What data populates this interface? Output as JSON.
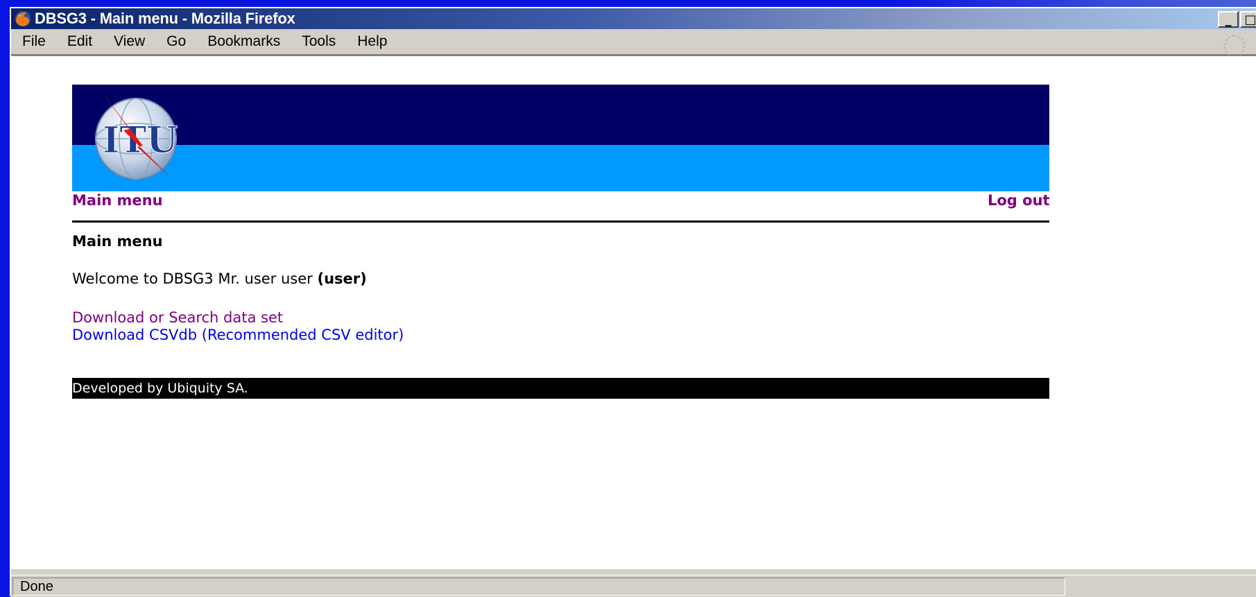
{
  "window": {
    "title": "DBSG3 - Main menu - Mozilla Firefox",
    "controls": {
      "minimize": "_",
      "maximize": "□",
      "close": "✕"
    }
  },
  "menubar": {
    "items": [
      "File",
      "Edit",
      "View",
      "Go",
      "Bookmarks",
      "Tools",
      "Help"
    ]
  },
  "banner": {
    "logo_text": "ITU"
  },
  "nav": {
    "main_menu": "Main menu",
    "log_out": "Log out"
  },
  "page": {
    "heading": "Main menu",
    "welcome_prefix": "Welcome to DBSG3 Mr. user user ",
    "welcome_role": "(user)",
    "links": [
      "Download or Search data set",
      "Download CSVdb (Recommended CSV editor)"
    ],
    "footer": "Developed by Ubiquity SA."
  },
  "status": {
    "text": "Done"
  },
  "colors": {
    "banner_dark": "#000066",
    "banner_light": "#0099ff",
    "visited_link": "#800080",
    "link": "#0000ee"
  }
}
